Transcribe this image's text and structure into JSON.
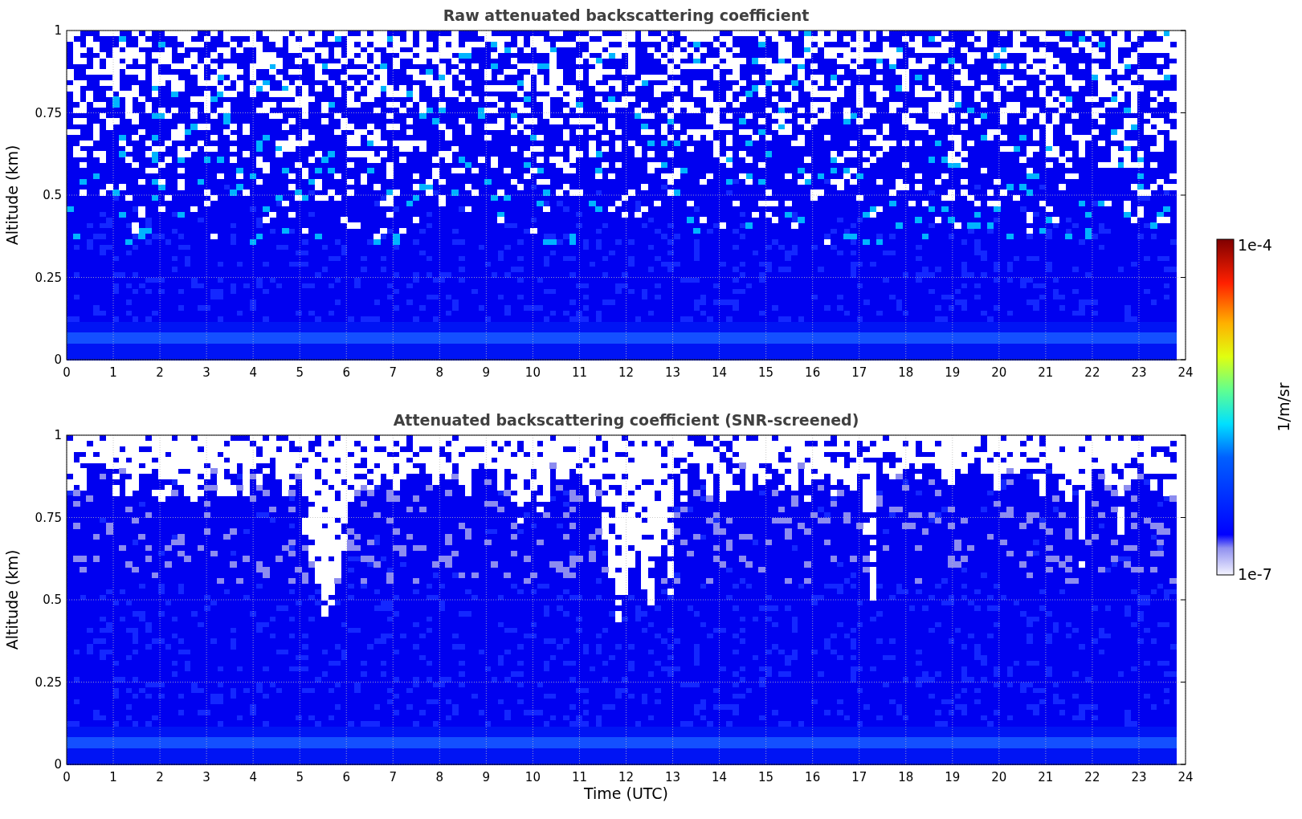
{
  "panels": [
    {
      "kind": "raw",
      "title": "Raw attenuated backscattering coefficient",
      "ylabel": "Altitude (km)",
      "yticks": [
        "1",
        "0.75",
        "0.5",
        "0.25",
        "0"
      ],
      "xticks": [
        "0",
        "1",
        "2",
        "3",
        "4",
        "5",
        "6",
        "7",
        "8",
        "9",
        "10",
        "11",
        "12",
        "13",
        "14",
        "15",
        "16",
        "17",
        "18",
        "19",
        "20",
        "21",
        "22",
        "23",
        "24"
      ]
    },
    {
      "kind": "screened",
      "title": "Attenuated backscattering coefficient (SNR-screened)",
      "ylabel": "Altitude (km)",
      "yticks": [
        "1",
        "0.75",
        "0.5",
        "0.25",
        "0"
      ],
      "xticks": [
        "0",
        "1",
        "2",
        "3",
        "4",
        "5",
        "6",
        "7",
        "8",
        "9",
        "10",
        "11",
        "12",
        "13",
        "14",
        "15",
        "16",
        "17",
        "18",
        "19",
        "20",
        "21",
        "22",
        "23",
        "24"
      ]
    }
  ],
  "xlabel": "Time (UTC)",
  "colorbar": {
    "label": "1/m/sr",
    "max_label": "1e-4",
    "min_label": "1e-7"
  }
}
